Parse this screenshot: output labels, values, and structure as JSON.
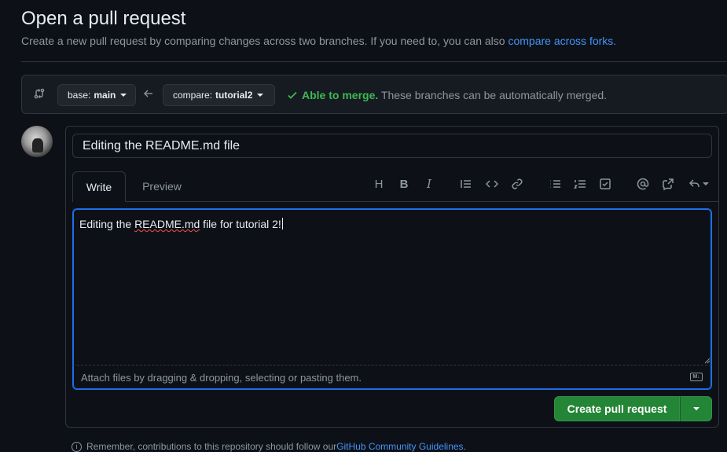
{
  "page": {
    "title": "Open a pull request",
    "subtitle_prefix": "Create a new pull request by comparing changes across two branches. If you need to, you can also ",
    "subtitle_link": "compare across forks."
  },
  "range": {
    "base_label": "base:",
    "base_value": "main",
    "compare_label": "compare:",
    "compare_value": "tutorial2",
    "merge_status": "Able to merge.",
    "merge_detail": "These branches can be automatically merged."
  },
  "form": {
    "title_value": "Editing the README.md file",
    "tabs": [
      "Write",
      "Preview"
    ],
    "body_prefix": "Editing the ",
    "body_misspelled": "README.md",
    "body_suffix": " file for tutorial 2!",
    "attach_hint": "Attach files by dragging & dropping, selecting or pasting them.",
    "markdown_badge": "M↓",
    "submit_label": "Create pull request"
  },
  "toolbar": {
    "heading": "H",
    "bold": "B",
    "italic": "I"
  },
  "footer": {
    "prefix": "Remember, contributions to this repository should follow our ",
    "link": "GitHub Community Guidelines",
    "suffix": "."
  },
  "colors": {
    "background": "#0d1117",
    "accent_link": "#4493f8",
    "success": "#3fb950",
    "primary_button": "#238636",
    "focus_border": "#1f6feb"
  }
}
